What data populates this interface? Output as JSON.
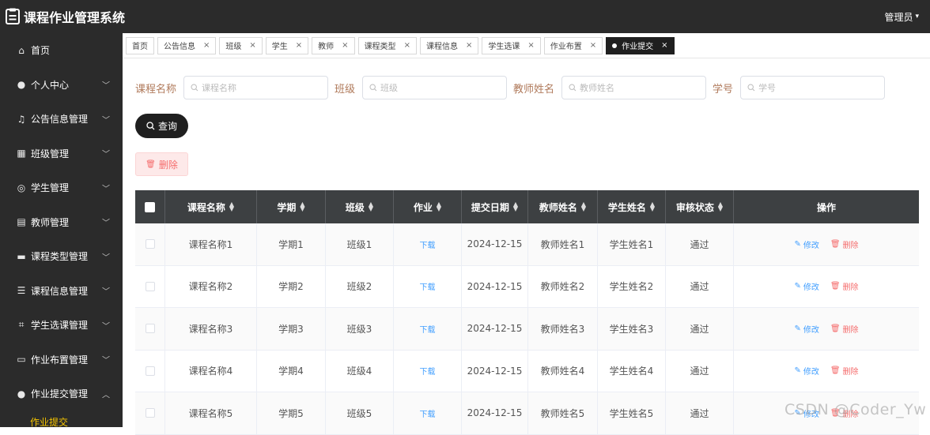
{
  "app": {
    "title": "课程作业管理系统",
    "user": "管理员"
  },
  "sidebar": {
    "items": [
      {
        "label": "首页",
        "icon": "home-icon",
        "glyph": "⌂",
        "chevron": ""
      },
      {
        "label": "个人中心",
        "icon": "user-icon",
        "glyph": "●",
        "chevron": "﹀"
      },
      {
        "label": "公告信息管理",
        "icon": "microphone-icon",
        "glyph": "♫",
        "chevron": "﹀"
      },
      {
        "label": "班级管理",
        "icon": "grid-icon",
        "glyph": "▦",
        "chevron": "﹀"
      },
      {
        "label": "学生管理",
        "icon": "circle-icon",
        "glyph": "◎",
        "chevron": "﹀"
      },
      {
        "label": "教师管理",
        "icon": "clipboard-icon",
        "glyph": "▤",
        "chevron": "﹀"
      },
      {
        "label": "课程类型管理",
        "icon": "briefcase-icon",
        "glyph": "▬",
        "chevron": "﹀"
      },
      {
        "label": "课程信息管理",
        "icon": "list-icon",
        "glyph": "☰",
        "chevron": "﹀"
      },
      {
        "label": "学生选课管理",
        "icon": "crop-icon",
        "glyph": "⌗",
        "chevron": "﹀"
      },
      {
        "label": "作业布置管理",
        "icon": "chat-icon",
        "glyph": "▭",
        "chevron": "﹀"
      },
      {
        "label": "作业提交管理",
        "icon": "user-icon",
        "glyph": "●",
        "chevron": "︿"
      }
    ],
    "active_sub": "作业提交"
  },
  "tabs": [
    {
      "label": "首页",
      "closable": false,
      "active": false
    },
    {
      "label": "公告信息",
      "closable": true,
      "active": false
    },
    {
      "label": "班级",
      "closable": true,
      "active": false
    },
    {
      "label": "学生",
      "closable": true,
      "active": false
    },
    {
      "label": "教师",
      "closable": true,
      "active": false
    },
    {
      "label": "课程类型",
      "closable": true,
      "active": false
    },
    {
      "label": "课程信息",
      "closable": true,
      "active": false
    },
    {
      "label": "学生选课",
      "closable": true,
      "active": false
    },
    {
      "label": "作业布置",
      "closable": true,
      "active": false
    },
    {
      "label": "作业提交",
      "closable": true,
      "active": true
    }
  ],
  "filters": [
    {
      "label": "课程名称",
      "placeholder": "课程名称"
    },
    {
      "label": "班级",
      "placeholder": "班级"
    },
    {
      "label": "教师姓名",
      "placeholder": "教师姓名"
    },
    {
      "label": "学号",
      "placeholder": "学号"
    }
  ],
  "buttons": {
    "search": "查询",
    "delete": "删除"
  },
  "table": {
    "headers": [
      "课程名称",
      "学期",
      "班级",
      "作业",
      "提交日期",
      "教师姓名",
      "学生姓名",
      "审核状态",
      "操作"
    ],
    "rows": [
      {
        "course": "课程名称1",
        "term": "学期1",
        "class": "班级1",
        "homework": "下载",
        "date": "2024-12-15",
        "teacher": "教师姓名1",
        "student": "学生姓名1",
        "status": "通过"
      },
      {
        "course": "课程名称2",
        "term": "学期2",
        "class": "班级2",
        "homework": "下载",
        "date": "2024-12-15",
        "teacher": "教师姓名2",
        "student": "学生姓名2",
        "status": "通过"
      },
      {
        "course": "课程名称3",
        "term": "学期3",
        "class": "班级3",
        "homework": "下载",
        "date": "2024-12-15",
        "teacher": "教师姓名3",
        "student": "学生姓名3",
        "status": "通过"
      },
      {
        "course": "课程名称4",
        "term": "学期4",
        "class": "班级4",
        "homework": "下载",
        "date": "2024-12-15",
        "teacher": "教师姓名4",
        "student": "学生姓名4",
        "status": "通过"
      },
      {
        "course": "课程名称5",
        "term": "学期5",
        "class": "班级5",
        "homework": "下载",
        "date": "2024-12-15",
        "teacher": "教师姓名5",
        "student": "学生姓名5",
        "status": "通过"
      }
    ],
    "actions": {
      "edit": "修改",
      "delete": "删除"
    }
  },
  "watermark": "CSDN @Coder_Yw",
  "colors": {
    "sidebar_bg": "#2b2b2b",
    "accent": "#1f1f1f",
    "link": "#409eff",
    "danger": "#f56c6c",
    "active_sub": "#f5c400",
    "label": "#b07a5b"
  }
}
